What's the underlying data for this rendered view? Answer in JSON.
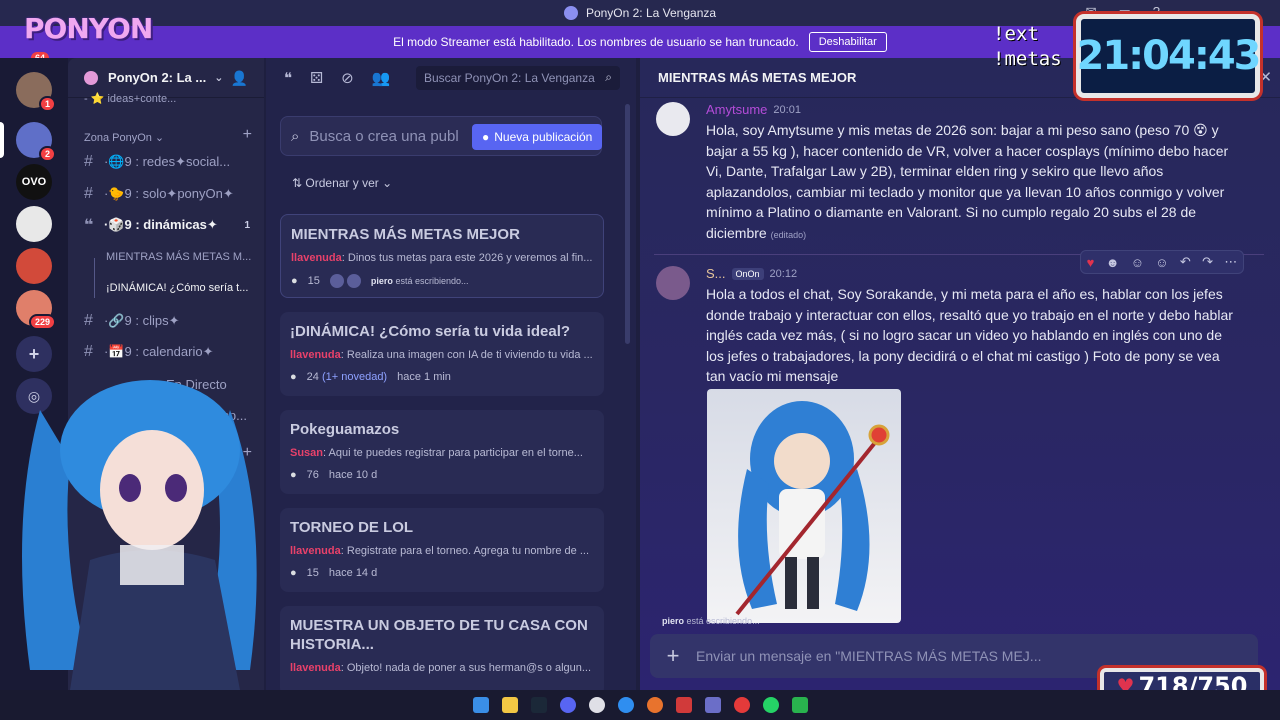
{
  "window": {
    "title": "PonyOn 2: La Venganza"
  },
  "banner": {
    "text": "El modo Streamer está habilitado. Los nombres de usuario se han truncado.",
    "button": "Deshabilitar"
  },
  "logo": {
    "text": "PONYON",
    "badge": "64"
  },
  "rail": [
    {
      "name": "avatar-server",
      "badge": "1",
      "color": "#8a6c5c"
    },
    {
      "name": "anime-server",
      "badge": "2",
      "color": "#5f6fc8"
    },
    {
      "name": "ovo-server",
      "badge": "",
      "color": "#111111",
      "text": "OVO"
    },
    {
      "name": "skull-server",
      "badge": "",
      "color": "#e8e8e8"
    },
    {
      "name": "red-server",
      "badge": "",
      "color": "#d24a3a"
    },
    {
      "name": "anime2-server",
      "badge": "229",
      "color": "#e07f6a"
    }
  ],
  "sidebar": {
    "guild_name": "PonyOn 2: La ...",
    "top_partial": "- ⭐ ideas+conte...",
    "category": "Zona PonyOn",
    "channels": [
      {
        "label": "·🌐9 : redes✦social...",
        "icon": "#"
      },
      {
        "label": "·🐤9 : solo✦ponyOn✦",
        "icon": "#"
      },
      {
        "label": "·🎲9 : dinámicas✦",
        "icon": "forum",
        "count": "1"
      }
    ],
    "threads": [
      "MIENTRAS MÁS METAS M...",
      "¡DINÁMICA! ¿Cómo sería t..."
    ],
    "channels2": [
      {
        "label": "·🔗9 : clips✦",
        "icon": "#"
      },
      {
        "label": "·📅9 : calendario✦",
        "icon": "#"
      },
      {
        "label": "En Directo",
        "icon": "speaker"
      },
      {
        "label": "Sala de Esp...",
        "icon": "speaker"
      }
    ]
  },
  "forum": {
    "search_placeholder": "Buscar PonyOn 2: La Venganza",
    "post_search_placeholder": "Busca o crea una publ",
    "new_post": "Nueva publicación",
    "sort": "Ordenar y ver",
    "cards": [
      {
        "title": "MIENTRAS MÁS METAS MEJOR",
        "author": "llavenuda",
        "preview": "Dinos tus metas para este 2026 y veremos al fin...",
        "replies": "15",
        "typing_user": "piero",
        "typing_text": "está escribiendo..."
      },
      {
        "title": "¡DINÁMICA! ¿Cómo sería tu vida ideal?",
        "author": "llavenuda",
        "preview": "Realiza una imagen con IA de ti viviendo tu vida ...",
        "replies": "24",
        "new": "(1+ novedad)",
        "ago": "hace 1 min"
      },
      {
        "title": "Pokeguamazos",
        "author": "Susan",
        "preview": "Aqui te puedes registrar para participar en el torne...",
        "replies": "76",
        "ago": "hace 10 d"
      },
      {
        "title": "TORNEO DE LOL",
        "author": "llavenuda",
        "preview": "Registrate para el torneo. Agrega tu nombre de ...",
        "replies": "15",
        "ago": "hace 14 d"
      },
      {
        "title": "MUESTRA UN OBJETO DE TU CASA CON HISTORIA...",
        "author": "llavenuda",
        "preview": "Objeto! nada de poner a sus herman@s o algun..."
      }
    ]
  },
  "chat": {
    "title": "MIENTRAS MÁS METAS MEJOR",
    "messages": [
      {
        "author": "Amytsume",
        "time": "20:01",
        "body": "Hola, soy Amytsume y mis metas de 2026 son: bajar a mi peso sano (peso 70 😵 y bajar a 55 kg ), hacer contenido de VR, volver a hacer cosplays (mínimo debo hacer Vi, Dante, Trafalgar Law y 2B), terminar elden ring y sekiro que llevo años aplazandolos, cambiar mi teclado y monitor que ya llevan 10 años conmigo y volver mínimo a Platino o diamante en Valorant.  Si no cumplo regalo 20 subs el 28 de diciembre",
        "edited": "(editado)"
      },
      {
        "author": "S...",
        "tag": "OnOn",
        "time": "20:12",
        "body": "Hola a todos el chat, Soy Sorakande, y mi meta para el año es, hablar con los jefes donde trabajo y interactuar con ellos, resaltó que yo trabajo en el norte y debo hablar inglés cada vez más, ( si no logro sacar un video yo hablando en inglés con uno de los jefes o trabajadores, la pony decidirá o el chat mi castigo )  Foto de pony se vea tan vacío mi mensaje"
      }
    ],
    "typing_user": "piero",
    "typing_text": "está escribiendo...",
    "composer_placeholder": "Enviar un mensaje en \"MIENTRAS MÁS METAS MEJ..."
  },
  "overlay": {
    "ext_line1": "!ext",
    "ext_line2": "!metas",
    "clock": "21:04:43",
    "counter": "718/750"
  }
}
